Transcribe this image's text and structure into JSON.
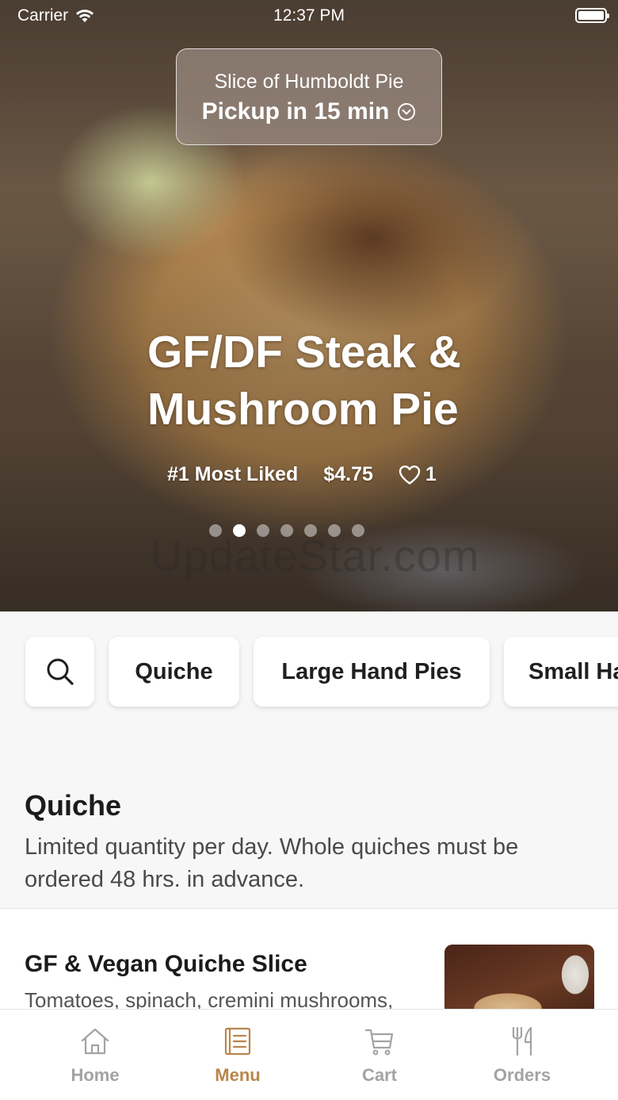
{
  "status_bar": {
    "carrier": "Carrier",
    "time": "12:37 PM"
  },
  "pickup": {
    "store": "Slice of Humboldt Pie",
    "time": "Pickup in 15 min"
  },
  "hero": {
    "title_line1": "GF/DF Steak &",
    "title_line2": "Mushroom Pie",
    "rank": "#1 Most Liked",
    "price": "$4.75",
    "likes": "1",
    "slides": 7,
    "active_slide": 2,
    "watermark": "UpdateStar.com"
  },
  "categories": {
    "search_icon": "search-icon",
    "items": [
      "Quiche",
      "Large Hand Pies",
      "Small Ha"
    ]
  },
  "section": {
    "title": "Quiche",
    "description": "Limited quantity per day.  Whole quiches must be ordered 48 hrs. in advance."
  },
  "menu_item": {
    "name": "GF & Vegan Quiche Slice",
    "description": "Tomatoes, spinach, cremini mushrooms,"
  },
  "tabs": [
    {
      "label": "Home",
      "icon": "home-icon",
      "active": false
    },
    {
      "label": "Menu",
      "icon": "menu-icon",
      "active": true
    },
    {
      "label": "Cart",
      "icon": "cart-icon",
      "active": false
    },
    {
      "label": "Orders",
      "icon": "fork-knife-icon",
      "active": false
    }
  ],
  "colors": {
    "accent": "#b8864a",
    "inactive": "#a3a3a3"
  }
}
